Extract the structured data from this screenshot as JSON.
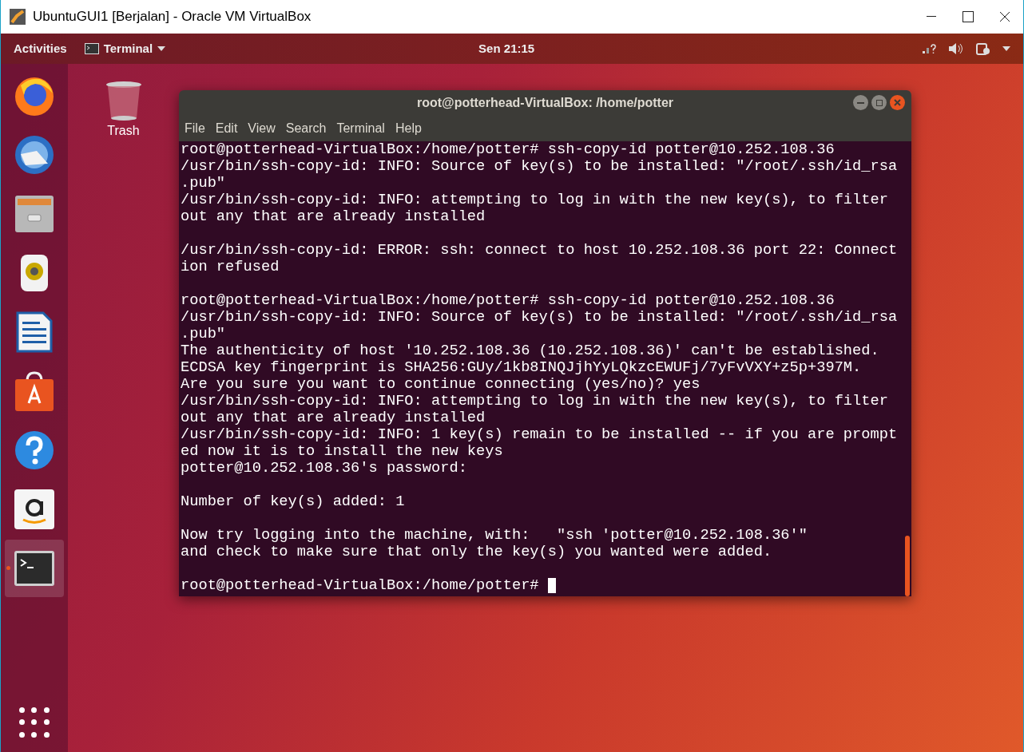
{
  "vm_window": {
    "title": "UbuntuGUI1 [Berjalan] - Oracle VM VirtualBox"
  },
  "top_bar": {
    "activities": "Activities",
    "app_menu": "Terminal",
    "clock": "Sen 21:15"
  },
  "dock": {
    "items": [
      {
        "kind": "firefox",
        "running": false
      },
      {
        "kind": "thunderbird",
        "running": false
      },
      {
        "kind": "files",
        "running": false
      },
      {
        "kind": "rhythmbox",
        "running": false
      },
      {
        "kind": "writer",
        "running": false
      },
      {
        "kind": "software",
        "running": false
      },
      {
        "kind": "help",
        "running": false
      },
      {
        "kind": "amazon",
        "running": false
      },
      {
        "kind": "terminal",
        "running": true
      }
    ]
  },
  "desktop_icons": [
    {
      "label": "Trash"
    }
  ],
  "terminal": {
    "title": "root@potterhead-VirtualBox: /home/potter",
    "menu": [
      "File",
      "Edit",
      "View",
      "Search",
      "Terminal",
      "Help"
    ],
    "blocks": [
      [
        "root@potterhead-VirtualBox:/home/potter# ssh-copy-id potter@10.252.108.36",
        "/usr/bin/ssh-copy-id: INFO: Source of key(s) to be installed: \"/root/.ssh/id_rsa",
        ".pub\"",
        "/usr/bin/ssh-copy-id: INFO: attempting to log in with the new key(s), to filter",
        "out any that are already installed"
      ],
      [
        "/usr/bin/ssh-copy-id: ERROR: ssh: connect to host 10.252.108.36 port 22: Connect",
        "ion refused"
      ],
      [
        "root@potterhead-VirtualBox:/home/potter# ssh-copy-id potter@10.252.108.36",
        "/usr/bin/ssh-copy-id: INFO: Source of key(s) to be installed: \"/root/.ssh/id_rsa",
        ".pub\"",
        "The authenticity of host '10.252.108.36 (10.252.108.36)' can't be established.",
        "ECDSA key fingerprint is SHA256:GUy/1kb8INQJjhYyLQkzcEWUFj/7yFvVXY+z5p+397M.",
        "Are you sure you want to continue connecting (yes/no)? yes",
        "/usr/bin/ssh-copy-id: INFO: attempting to log in with the new key(s), to filter",
        "out any that are already installed",
        "/usr/bin/ssh-copy-id: INFO: 1 key(s) remain to be installed -- if you are prompt",
        "ed now it is to install the new keys",
        "potter@10.252.108.36's password:"
      ],
      [
        "Number of key(s) added: 1"
      ],
      [
        "Now try logging into the machine, with:   \"ssh 'potter@10.252.108.36'\"",
        "and check to make sure that only the key(s) you wanted were added."
      ],
      [
        "root@potterhead-VirtualBox:/home/potter# "
      ]
    ],
    "cursor": true
  }
}
